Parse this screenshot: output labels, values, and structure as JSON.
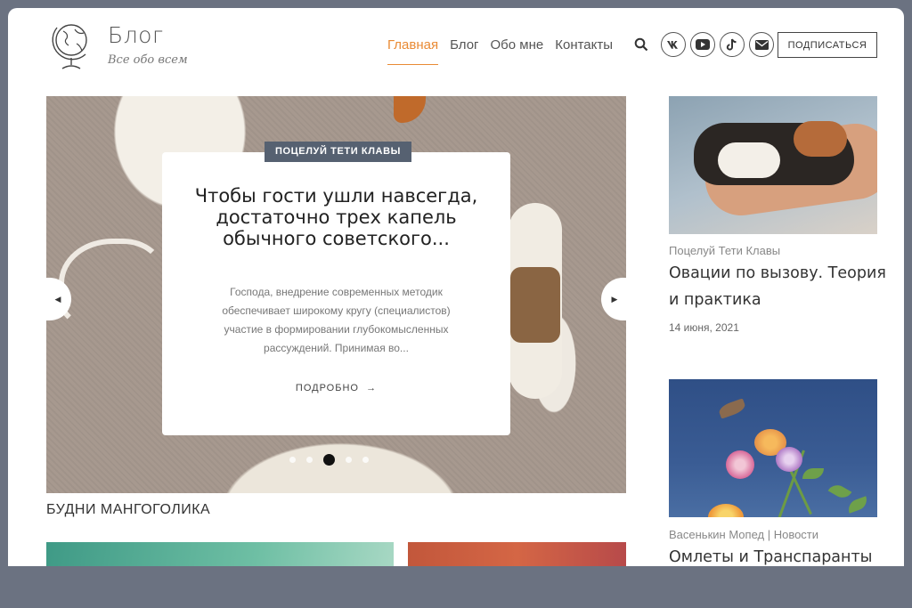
{
  "brand": {
    "title": "Блог",
    "subtitle": "Все обо всем",
    "logo_icon": "globe-icon"
  },
  "nav": {
    "items": [
      {
        "label": "Главная",
        "active": true
      },
      {
        "label": "Блог",
        "active": false
      },
      {
        "label": "Обо мне",
        "active": false
      },
      {
        "label": "Контакты",
        "active": false
      }
    ],
    "accent_color": "#e98a34"
  },
  "social": [
    "vk-icon",
    "youtube-icon",
    "tiktok-icon",
    "mail-icon"
  ],
  "subscribe_label": "ПОДПИСАТЬСЯ",
  "slider": {
    "badge": "ПОЦЕЛУЙ ТЕТИ КЛАВЫ",
    "title": "Чтобы гости ушли навсегда, достаточно трех капель обычного советского...",
    "excerpt": "Господа, внедрение современных методик обеспечивает широкому кругу (специалистов) участие в формировании глубокомысленных рассуждений. Принимая во...",
    "more_label": "ПОДРОБНО",
    "slides_total": 5,
    "active_slide": 3
  },
  "section_heading": "БУДНИ МАНГОГОЛИКА",
  "sidebar": {
    "posts": [
      {
        "category": "Поцелуй Тети Клавы",
        "title": "Овации по вызову. Теория и практика",
        "date": "14 июня, 2021"
      },
      {
        "category": "Васенькин Мопед | Новости",
        "title": "Омлеты и Транспаранты",
        "date": ""
      }
    ]
  }
}
